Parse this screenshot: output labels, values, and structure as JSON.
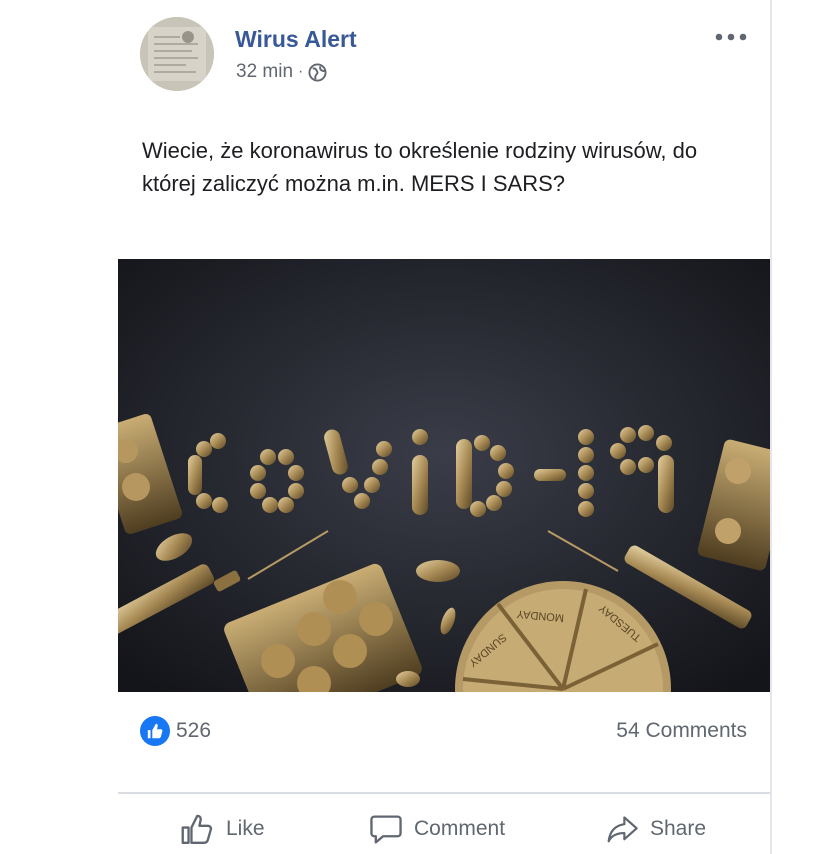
{
  "post": {
    "page_name": "Wirus Alert",
    "time": "32 min",
    "separator": "·",
    "privacy_icon": "globe-icon",
    "more_icon": "more-options-icon",
    "text": "Wiecie, że koronawirus to określenie rodziny wirusów, do której zaliczyć można m.in. MERS I SARS?",
    "image": {
      "banner_text": "COVID-19",
      "pill_box_labels": [
        "MONDAY",
        "TUESDAY",
        "SUNDAY"
      ]
    }
  },
  "stats": {
    "reaction_icon": "like-reaction-icon",
    "likes": "526",
    "comments": "54 Comments"
  },
  "actions": {
    "like": "Like",
    "comment": "Comment",
    "share": "Share"
  },
  "colors": {
    "name": "#385898",
    "secondary_text": "#606770",
    "like_blue": "#1877f2"
  }
}
